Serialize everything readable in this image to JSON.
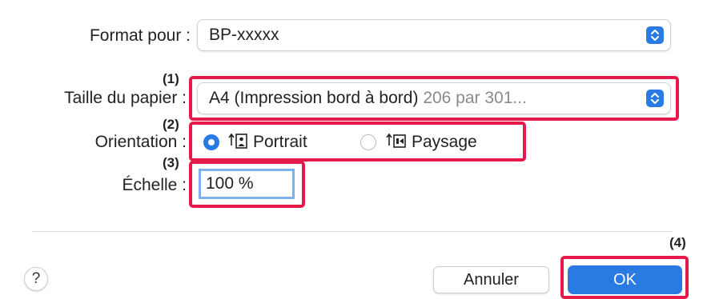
{
  "format_row": {
    "label": "Format pour :",
    "value": "BP-xxxxx"
  },
  "paper_row": {
    "label": "Taille du papier :",
    "value_main": "A4 (Impression bord à bord)",
    "value_detail": "206 par 301...",
    "callout": "(1)"
  },
  "orientation_row": {
    "label": "Orientation :",
    "callout": "(2)",
    "options": [
      {
        "label": "Portrait",
        "selected": true,
        "icon": "portrait-orientation-icon"
      },
      {
        "label": "Paysage",
        "selected": false,
        "icon": "landscape-orientation-icon"
      }
    ]
  },
  "scale_row": {
    "label": "Échelle :",
    "value": "100 %",
    "callout": "(3)"
  },
  "footer": {
    "help": "?",
    "cancel_label": "Annuler",
    "ok_label": "OK",
    "ok_callout": "(4)"
  },
  "colors": {
    "accent": "#2a7ae4",
    "highlight": "#e41a4a",
    "focus_ring": "#7fb0ee"
  },
  "icons": {
    "popup_stepper": "up-down-chevron-icon",
    "help": "question-mark-icon"
  }
}
